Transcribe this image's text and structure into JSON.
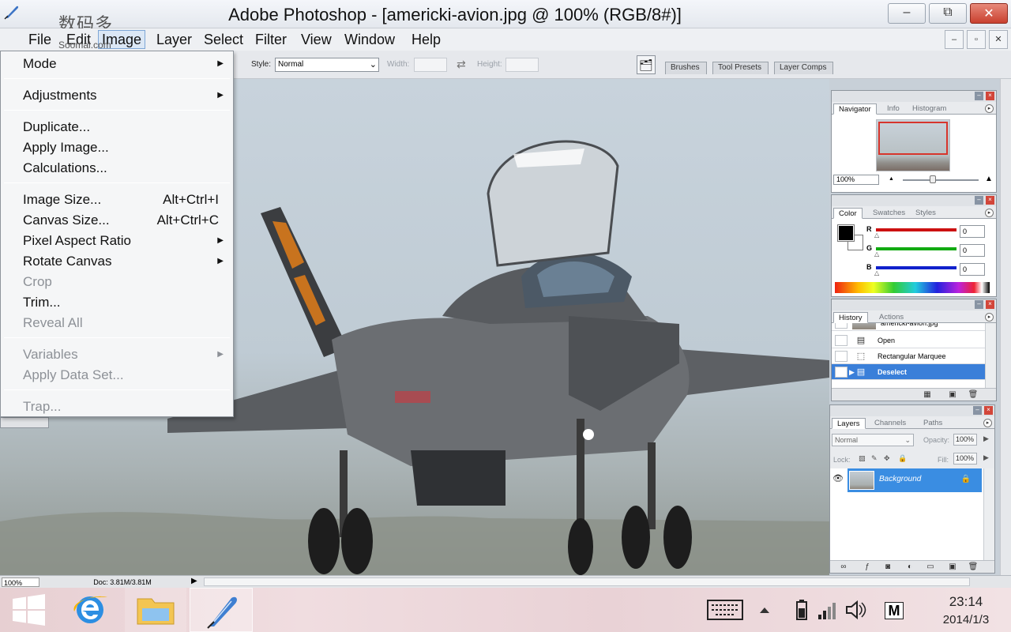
{
  "window": {
    "title": "Adobe Photoshop - [americki-avion.jpg @ 100% (RGB/8#)]",
    "watermark": "数码多",
    "watermark_sub": "Soomal.com",
    "controls": {
      "minimize": "–",
      "restore": "⧉",
      "close": "✕"
    },
    "doc_controls": {
      "minimize": "–",
      "restore": "▫",
      "close": "✕"
    }
  },
  "menubar": {
    "items": [
      {
        "label": "File"
      },
      {
        "label": "Edit"
      },
      {
        "label": "Image"
      },
      {
        "label": "Layer"
      },
      {
        "label": "Select"
      },
      {
        "label": "Filter"
      },
      {
        "label": "View"
      },
      {
        "label": "Window"
      },
      {
        "label": "Help"
      }
    ],
    "active": "Image"
  },
  "options_bar": {
    "style_label": "Style:",
    "style_value": "Normal",
    "width_label": "Width:",
    "height_label": "Height:",
    "swap_icon": "⇄",
    "palette_icon": "🗂",
    "palette_tabs": [
      "Brushes",
      "Tool Presets",
      "Layer Comps"
    ]
  },
  "image_menu": {
    "items": [
      {
        "label": "Mode",
        "submenu": true
      },
      {
        "label": "Adjustments",
        "submenu": true
      },
      {
        "label": "Duplicate..."
      },
      {
        "label": "Apply Image..."
      },
      {
        "label": "Calculations..."
      },
      {
        "label": "Image Size...",
        "shortcut": "Alt+Ctrl+I"
      },
      {
        "label": "Canvas Size...",
        "shortcut": "Alt+Ctrl+C"
      },
      {
        "label": "Pixel Aspect Ratio",
        "submenu": true
      },
      {
        "label": "Rotate Canvas",
        "submenu": true
      },
      {
        "label": "Crop",
        "disabled": true
      },
      {
        "label": "Trim..."
      },
      {
        "label": "Reveal All",
        "disabled": true
      },
      {
        "label": "Variables",
        "submenu": true,
        "disabled": true
      },
      {
        "label": "Apply Data Set...",
        "disabled": true
      },
      {
        "label": "Trap...",
        "disabled": true
      }
    ],
    "submenu_glyph": "▶"
  },
  "navigator": {
    "tabs": [
      "Navigator",
      "Info",
      "Histogram"
    ],
    "zoom": "100%",
    "zoom_out_icon": "▲",
    "zoom_in_icon": "▲"
  },
  "color_panel": {
    "tabs": [
      "Color",
      "Swatches",
      "Styles"
    ],
    "channels": [
      {
        "label": "R",
        "value": "0",
        "bar": "#cc1111"
      },
      {
        "label": "G",
        "value": "0",
        "bar": "#11aa11"
      },
      {
        "label": "B",
        "value": "0",
        "bar": "#1122cc"
      }
    ],
    "knob": "△"
  },
  "history_panel": {
    "tabs": [
      "History",
      "Actions"
    ],
    "snapshot": "americki-avion.jpg",
    "steps": [
      {
        "label": "Open",
        "icon": "▤"
      },
      {
        "label": "Rectangular Marquee",
        "icon": "⬚"
      },
      {
        "label": "Deselect",
        "icon": "▤",
        "selected": true
      }
    ],
    "history_brush_icon": "▶",
    "foot_icons": [
      "▦",
      "▣",
      "🗑"
    ]
  },
  "layers_panel": {
    "tabs": [
      "Layers",
      "Channels",
      "Paths"
    ],
    "blend_mode": "Normal",
    "opacity_label": "Opacity:",
    "opacity": "100%",
    "lock_label": "Lock:",
    "fill_label": "Fill:",
    "fill": "100%",
    "lock_icons": [
      "▧",
      "✎",
      "✥",
      "🔒"
    ],
    "layer_name": "Background",
    "eye_icon": "👁",
    "lock_icon": "🔒",
    "foot_icons": [
      "∞",
      "ƒ",
      "◙",
      "◐",
      "▭",
      "▣",
      "🗑"
    ]
  },
  "status_bar": {
    "zoom": "100%",
    "doc": "Doc: 3.81M/3.81M",
    "arrow": "▶"
  },
  "taskbar": {
    "time": "23:14",
    "date": "2014/1/3",
    "ime": "M"
  },
  "colors": {
    "selection": "#3a7fd9",
    "menu_active": "#dbe7f5",
    "close_button": "#c9402f"
  }
}
